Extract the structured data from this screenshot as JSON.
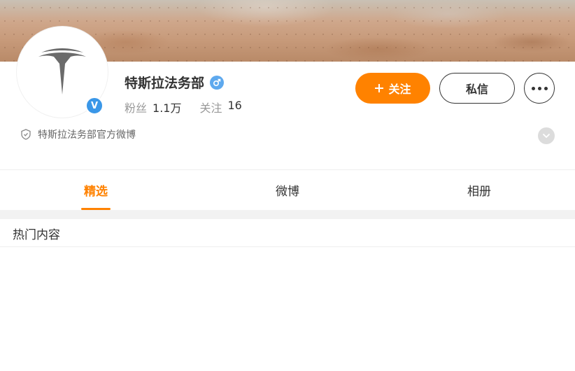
{
  "profile": {
    "name": "特斯拉法务部",
    "gender": "male",
    "verified": true,
    "verified_mark": "V",
    "description": "特斯拉法务部官方微博",
    "stats": {
      "followers_label": "粉丝",
      "followers_value": "1.1万",
      "following_label": "关注",
      "following_value": "16"
    }
  },
  "actions": {
    "follow_label": "关注",
    "message_label": "私信"
  },
  "tabs": [
    {
      "label": "精选",
      "active": true
    },
    {
      "label": "微博",
      "active": false
    },
    {
      "label": "相册",
      "active": false
    }
  ],
  "section": {
    "title": "热门内容"
  },
  "colors": {
    "accent": "#ff8200",
    "verified_blue": "#3a97e8",
    "gender_blue": "#5ea9ee"
  },
  "icons": [
    "tesla-logo-icon",
    "verified-icon",
    "male-icon",
    "plus-icon",
    "more-icon",
    "shield-icon",
    "chevron-down-icon"
  ]
}
